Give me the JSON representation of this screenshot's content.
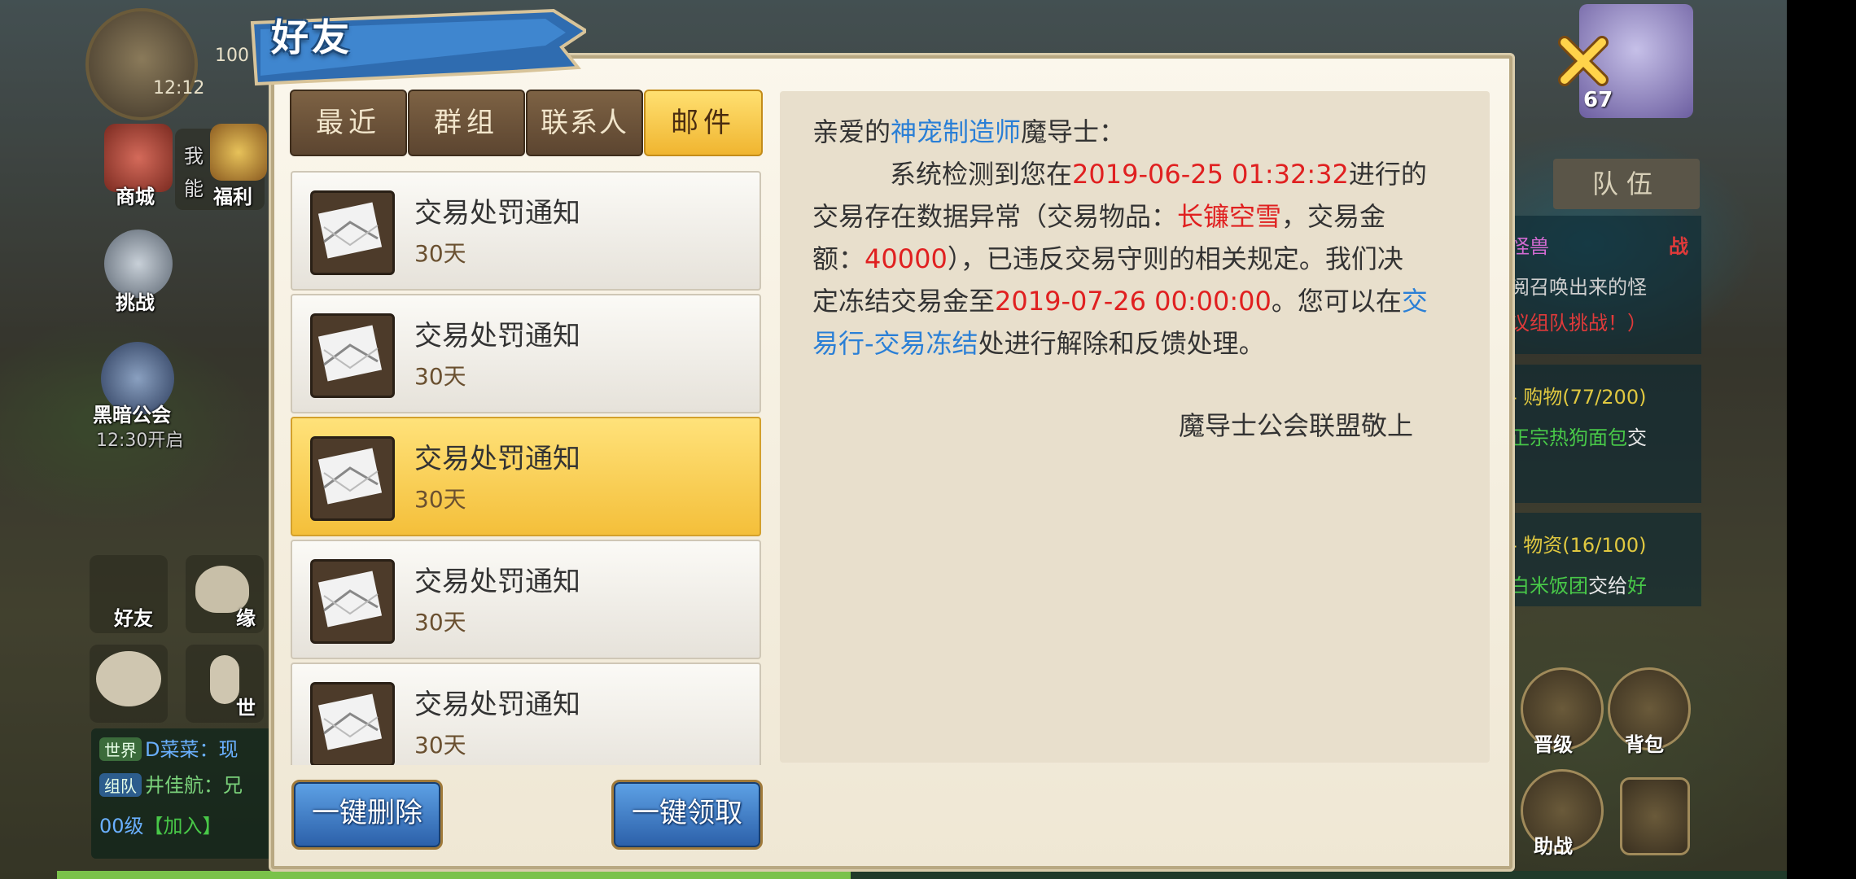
{
  "dialog": {
    "title": "好友",
    "tabs": [
      {
        "label": "最近"
      },
      {
        "label": "群组"
      },
      {
        "label": "联系人"
      },
      {
        "label": "邮件"
      }
    ],
    "active_tab_index": 3
  },
  "mail_list": [
    {
      "subject": "交易处罚通知",
      "days": "30天"
    },
    {
      "subject": "交易处罚通知",
      "days": "30天"
    },
    {
      "subject": "交易处罚通知",
      "days": "30天"
    },
    {
      "subject": "交易处罚通知",
      "days": "30天"
    },
    {
      "subject": "交易处罚通知",
      "days": "30天"
    }
  ],
  "selected_mail_index": 2,
  "mail_content": {
    "greeting_prefix": "亲爱的",
    "greeting_title": "神宠制造师",
    "greeting_suffix": "魔导士：",
    "p1_a": "系统检测到您在",
    "p1_date": "2019-06-25 01:32:32",
    "p1_b": "进行的",
    "p2_a": "交易存在数据异常（交易物品：",
    "p2_item": "长镰空雪",
    "p2_b": "，交易金",
    "p3_a": "额：",
    "p3_amount": "40000",
    "p3_b": "），已违反交易守则的相关规定。我们决",
    "p4_a": "定冻结交易金至",
    "p4_date": "2019-07-26 00:00:00",
    "p4_b": "。您可以在",
    "p4_link": "交",
    "p5_link": "易行-交易冻结",
    "p5_b": "处进行解除和反馈处理。",
    "signature": "魔导士公会联盟敬上"
  },
  "buttons": {
    "delete_all": "一键删除",
    "claim_all": "一键领取"
  },
  "hud": {
    "level_text": "100",
    "time_text": "12:12",
    "shop_label": "商城",
    "welfare_label": "福利",
    "welfare_hint_a": "我",
    "welfare_hint_b": "能",
    "challenge_label": "挑战",
    "guild_label": "黑暗公会",
    "guild_time": "12:30开启",
    "friend_label": "好友",
    "fate_label": "缘",
    "world_label": "世",
    "chat": {
      "line1_tag": "世界",
      "line1_text": "D菜菜：现",
      "line2_tag": "组队",
      "line2_text": "井佳航：兄",
      "line3_text": "00级",
      "line3_join": "【加入】"
    },
    "player_level": "67",
    "team_tab": "队伍",
    "quest1_a": "怪兽",
    "quest1_b": "战",
    "quest1_c": "阅召唤出来的怪",
    "quest1_d": "议组队挑战！）",
    "quest2_title": "- 购物(77/200)",
    "quest2_a": "正宗热狗面包",
    "quest2_b": "交",
    "quest3_title": "- 物资(16/100)",
    "quest3_a": "白米饭团",
    "quest3_b": "交给",
    "quest3_c": "好",
    "upgrade_label": "晋级",
    "bag_label": "背包",
    "assist_label": "助战"
  },
  "colors": {
    "accent_gold": "#f4bf3a",
    "link_blue": "#2a7fd6",
    "alert_red": "#e02020",
    "button_blue": "#2b5fa8"
  }
}
